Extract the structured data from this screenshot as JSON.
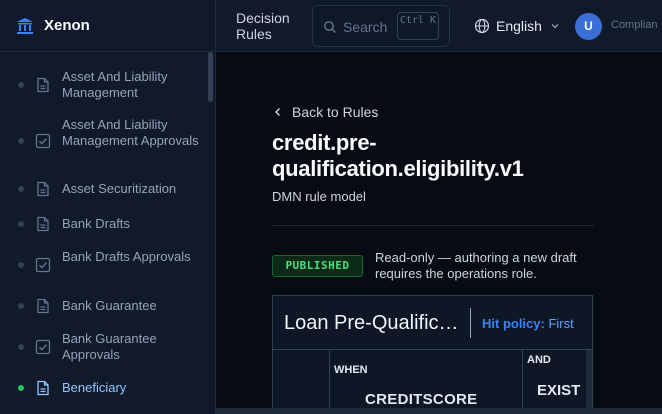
{
  "app": {
    "name": "Xenon"
  },
  "sidebar": {
    "items": [
      {
        "label": "Asset And Liability Management",
        "icon": "document-icon",
        "active": false
      },
      {
        "label": "Asset And Liability Management Approvals",
        "icon": "checkbox-icon",
        "active": false
      },
      {
        "label": "Asset Securitization",
        "icon": "document-icon",
        "active": false
      },
      {
        "label": "Bank Drafts",
        "icon": "document-icon",
        "active": false
      },
      {
        "label": "Bank Drafts Approvals",
        "icon": "checkbox-icon",
        "active": false
      },
      {
        "label": "Bank Guarantee",
        "icon": "document-icon",
        "active": false
      },
      {
        "label": "Bank Guarantee Approvals",
        "icon": "checkbox-icon",
        "active": false
      },
      {
        "label": "Beneficiary",
        "icon": "document-icon",
        "active": true
      }
    ]
  },
  "header": {
    "page_title": "Decision Rules",
    "search": {
      "placeholder": "Search",
      "shortcut": "Ctrl K"
    },
    "language": "English",
    "avatar_initial": "U",
    "user_role": "Complian"
  },
  "main": {
    "back_label": "Back to Rules",
    "rule_title": "credit.pre-qualification.eligibility.v1",
    "subtitle": "DMN rule model",
    "status_badge": "PUBLISHED",
    "notice": "Read-only — authoring a new draft requires the operations role.",
    "table": {
      "name": "Loan Pre-Qualification",
      "hit_policy_label": "Hit policy:",
      "hit_policy_value": "First",
      "when_label": "WHEN",
      "input_field": "CREDITSCORE",
      "and_label": "AND",
      "second_field": "EXIST"
    }
  },
  "colors": {
    "accent": "#3b82f6",
    "published": "#4ade80",
    "active_dot": "#22c55e",
    "sidebar_bg": "#111a2b",
    "main_bg": "#070b14"
  }
}
